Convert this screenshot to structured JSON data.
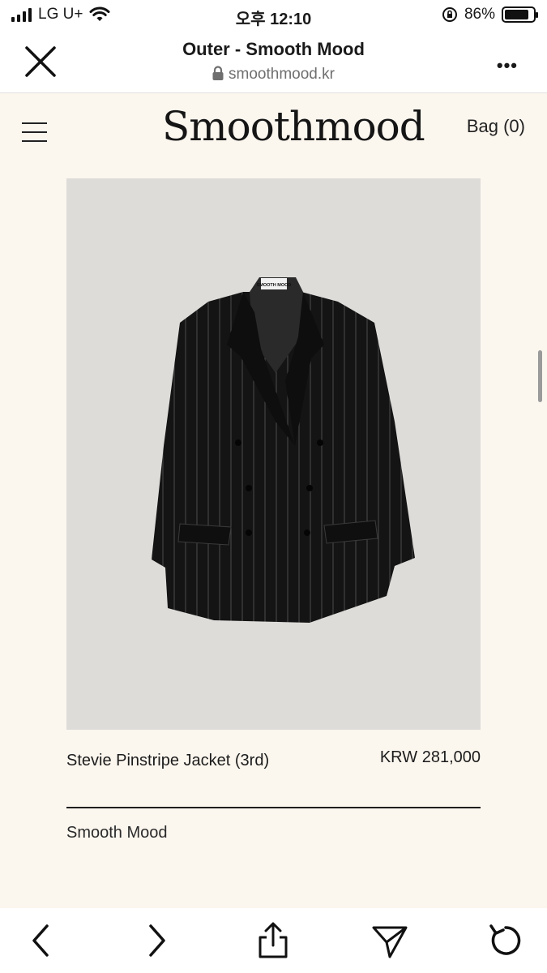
{
  "status_bar": {
    "carrier": "LG U+",
    "time": "오후 12:10",
    "battery": "86%",
    "battery_level": 0.86
  },
  "browser": {
    "title": "Outer - Smooth Mood",
    "url": "smoothmood.kr"
  },
  "site": {
    "logo": "Smoothmood",
    "bag_label": "Bag (0)"
  },
  "product": {
    "name": "Stevie Pinstripe Jacket (3rd)",
    "price": "KRW 281,000",
    "brand": "Smooth Mood",
    "label_text": "SMOOTH MOOD"
  },
  "icons": {
    "close": "close-icon",
    "more": "more-icon",
    "menu": "hamburger-menu-icon",
    "back": "chevron-left-icon",
    "forward": "chevron-right-icon",
    "share": "share-icon",
    "send": "send-icon",
    "reload": "reload-icon",
    "lock": "lock-icon"
  }
}
